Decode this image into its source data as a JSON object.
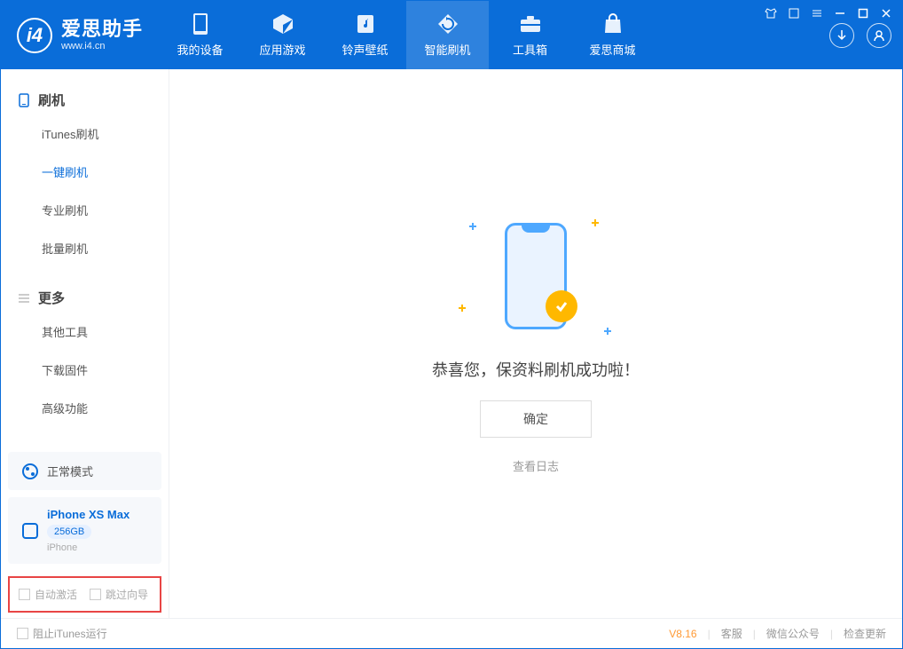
{
  "app": {
    "title": "爱思助手",
    "subtitle": "www.i4.cn"
  },
  "nav": {
    "items": [
      {
        "label": "我的设备"
      },
      {
        "label": "应用游戏"
      },
      {
        "label": "铃声壁纸"
      },
      {
        "label": "智能刷机"
      },
      {
        "label": "工具箱"
      },
      {
        "label": "爱思商城"
      }
    ]
  },
  "sidebar": {
    "section1": {
      "title": "刷机",
      "items": [
        "iTunes刷机",
        "一键刷机",
        "专业刷机",
        "批量刷机"
      ]
    },
    "section2": {
      "title": "更多",
      "items": [
        "其他工具",
        "下载固件",
        "高级功能"
      ]
    },
    "mode_label": "正常模式",
    "device": {
      "name": "iPhone XS Max",
      "capacity": "256GB",
      "type": "iPhone"
    },
    "checks": {
      "auto_activate": "自动激活",
      "skip_guide": "跳过向导"
    }
  },
  "main": {
    "success_message": "恭喜您，保资料刷机成功啦！",
    "ok_label": "确定",
    "view_log": "查看日志"
  },
  "footer": {
    "block_itunes": "阻止iTunes运行",
    "version": "V8.16",
    "links": [
      "客服",
      "微信公众号",
      "检查更新"
    ]
  }
}
